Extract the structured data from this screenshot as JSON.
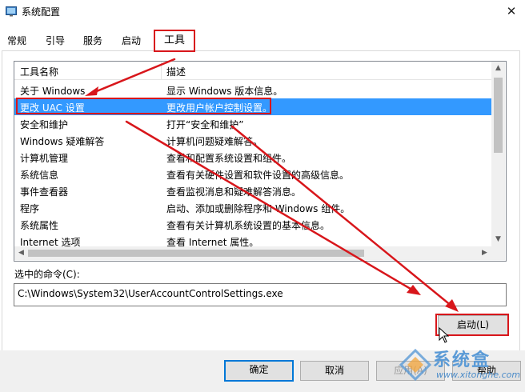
{
  "window": {
    "title": "系统配置",
    "close_glyph": "✕"
  },
  "tabs": [
    {
      "label": "常规"
    },
    {
      "label": "引导"
    },
    {
      "label": "服务"
    },
    {
      "label": "启动"
    },
    {
      "label": "工具"
    }
  ],
  "list": {
    "columns": [
      "工具名称",
      "描述"
    ],
    "rows": [
      {
        "name": "关于 Windows",
        "desc": "显示 Windows 版本信息。"
      },
      {
        "name": "更改 UAC 设置",
        "desc": "更改用户帐户控制设置。",
        "selected": true
      },
      {
        "name": "安全和维护",
        "desc": "打开“安全和维护”"
      },
      {
        "name": "Windows 疑难解答",
        "desc": "计算机问题疑难解答。"
      },
      {
        "name": "计算机管理",
        "desc": "查看和配置系统设置和组件。"
      },
      {
        "name": "系统信息",
        "desc": "查看有关硬件设置和软件设置的高级信息。"
      },
      {
        "name": "事件查看器",
        "desc": "查看监视消息和疑难解答消息。"
      },
      {
        "name": "程序",
        "desc": "启动、添加或删除程序和 Windows 组件。"
      },
      {
        "name": "系统属性",
        "desc": "查看有关计算机系统设置的基本信息。"
      },
      {
        "name": "Internet 选项",
        "desc": "查看 Internet 属性。"
      }
    ]
  },
  "command": {
    "label": "选中的命令(C):",
    "value": "C:\\Windows\\System32\\UserAccountControlSettings.exe"
  },
  "buttons": {
    "launch": "启动(L)",
    "ok": "确定",
    "cancel": "取消",
    "apply": "应用(A)",
    "help": "帮助"
  },
  "watermark": {
    "brand": "系统盒",
    "url": "www.xitonghe.com"
  },
  "colors": {
    "annotation_red": "#d8161b",
    "selection_blue": "#3399ff",
    "default_button_border": "#0078d7"
  }
}
